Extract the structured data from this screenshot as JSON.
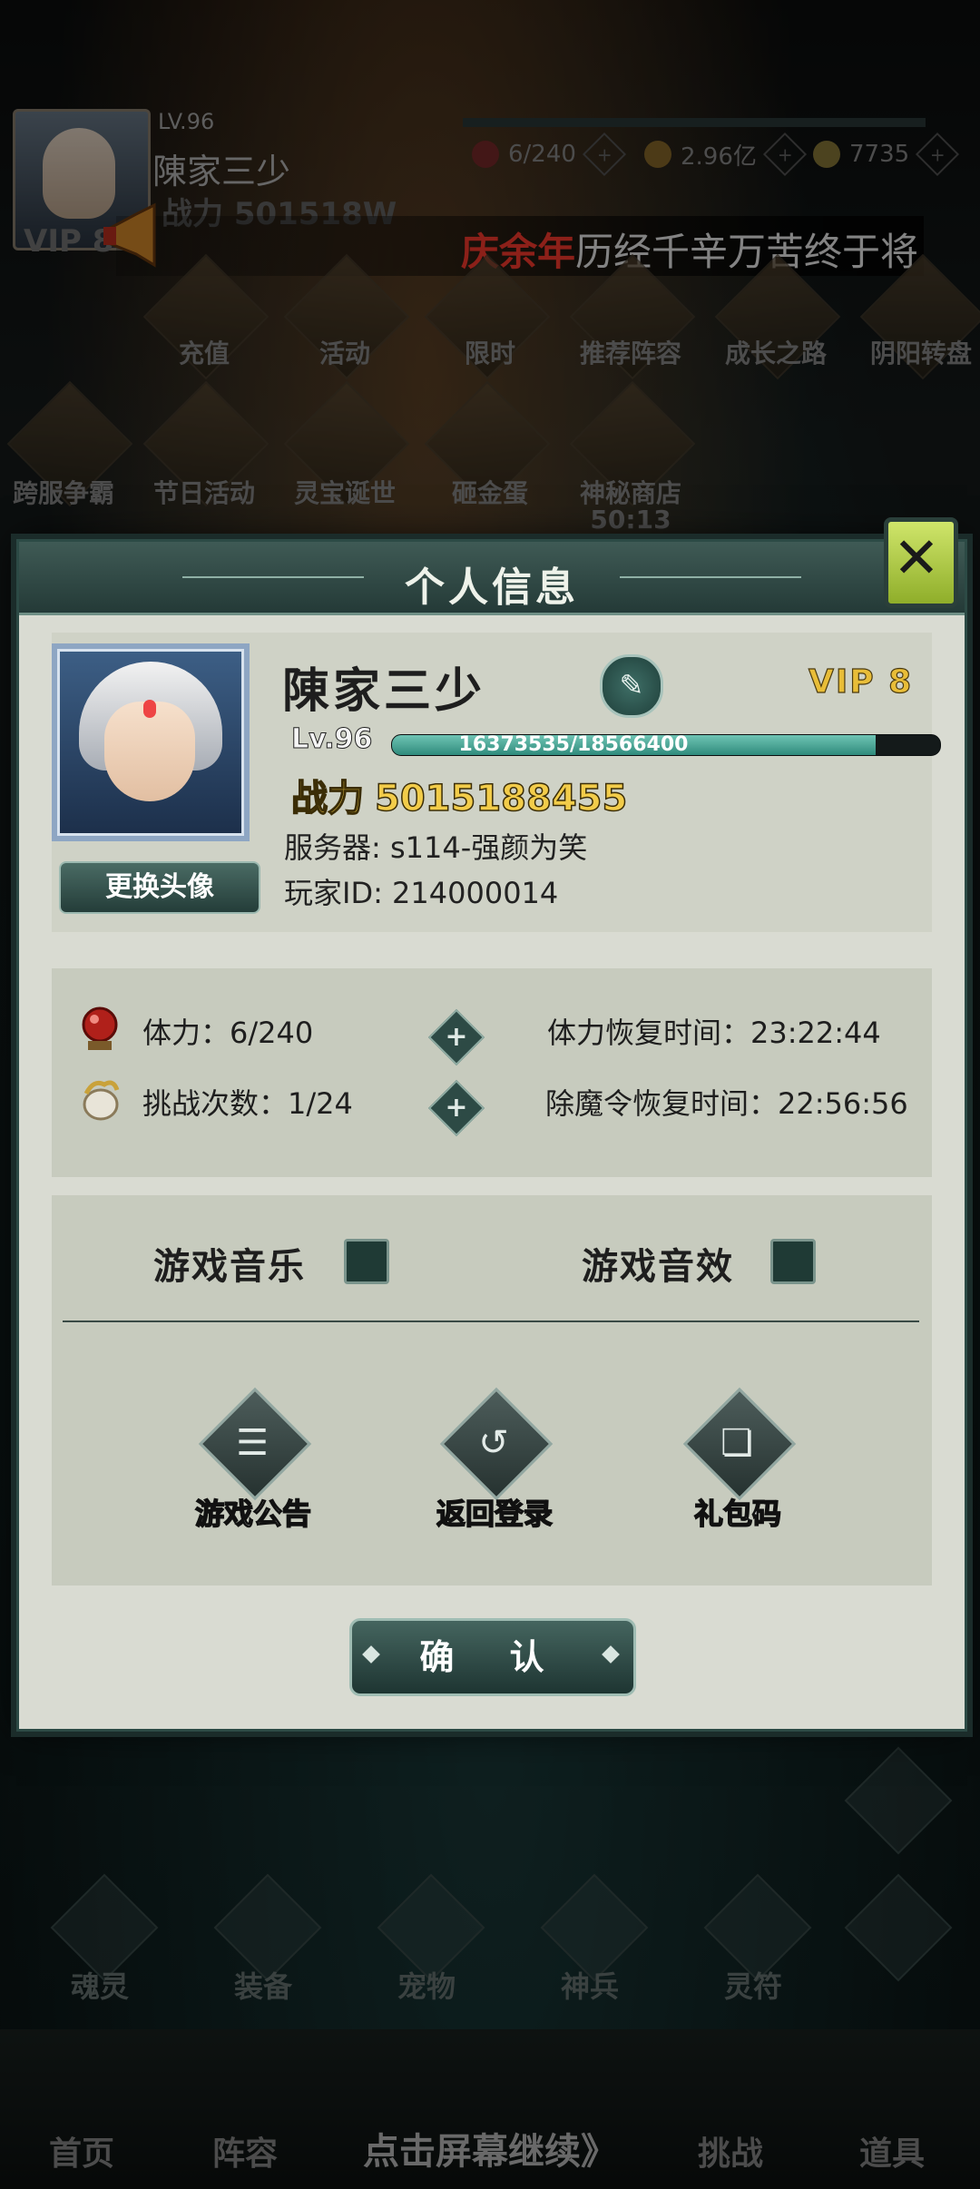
{
  "topbar": {
    "level": "LV.96",
    "name": "陳家三少",
    "power": "战力 501518W",
    "vip": "VIP 8",
    "resources": [
      {
        "icon": "stamina-orb-icon",
        "value": "6/240"
      },
      {
        "icon": "gold-coin-icon",
        "value": "2.96亿"
      },
      {
        "icon": "ingot-icon",
        "value": "7735"
      }
    ],
    "marquee_highlight": "庆余年",
    "marquee_text": "历经千辛万苦终于将"
  },
  "menu": [
    {
      "label": "充值"
    },
    {
      "label": "活动"
    },
    {
      "label": "限时"
    },
    {
      "label": "推荐阵容"
    },
    {
      "label": "成长之路"
    },
    {
      "label": "阴阳转盘"
    },
    {
      "label": "跨服争霸"
    },
    {
      "label": "节日活动"
    },
    {
      "label": "灵宝诞世"
    },
    {
      "label": "砸金蛋"
    },
    {
      "label": "神秘商店"
    }
  ],
  "shop_timer": "50:13",
  "dialog": {
    "title": "个人信息",
    "player_name": "陳家三少",
    "vip": "VIP 8",
    "level": "Lv.96",
    "exp_text": "16373535/18566400",
    "exp_fraction": 0.8819,
    "power_label": "战力",
    "power_value": "5015188455",
    "server": "服务器: s114-强颜为笑",
    "player_id": "玩家ID: 214000014",
    "change_avatar": "更换头像",
    "stamina": "体力：6/240",
    "stamina_recover": "体力恢复时间：23:22:44",
    "challenges": "挑战次数：1/24",
    "demon_recover": "除魔令恢复时间：22:56:56",
    "music": "游戏音乐",
    "sound": "游戏音效",
    "actions": [
      {
        "label": "游戏公告",
        "icon": "notice-board-icon"
      },
      {
        "label": "返回登录",
        "icon": "return-arrow-icon"
      },
      {
        "label": "礼包码",
        "icon": "gift-code-icon"
      }
    ],
    "confirm": "确 认"
  },
  "bottom_icons": [
    {
      "label": "魂灵"
    },
    {
      "label": "装备"
    },
    {
      "label": "宠物"
    },
    {
      "label": "神兵"
    },
    {
      "label": "灵符"
    }
  ],
  "tabs": [
    {
      "label": "首页"
    },
    {
      "label": "阵容"
    },
    {
      "label": "挑战"
    },
    {
      "label": "道具"
    }
  ],
  "continue_text": "点击屏幕继续》",
  "colors": {
    "panel": "#d9dbd2",
    "frame": "#2c4a45",
    "vip_gold": "#e8bd38",
    "marquee_red": "#ff3b2f"
  }
}
